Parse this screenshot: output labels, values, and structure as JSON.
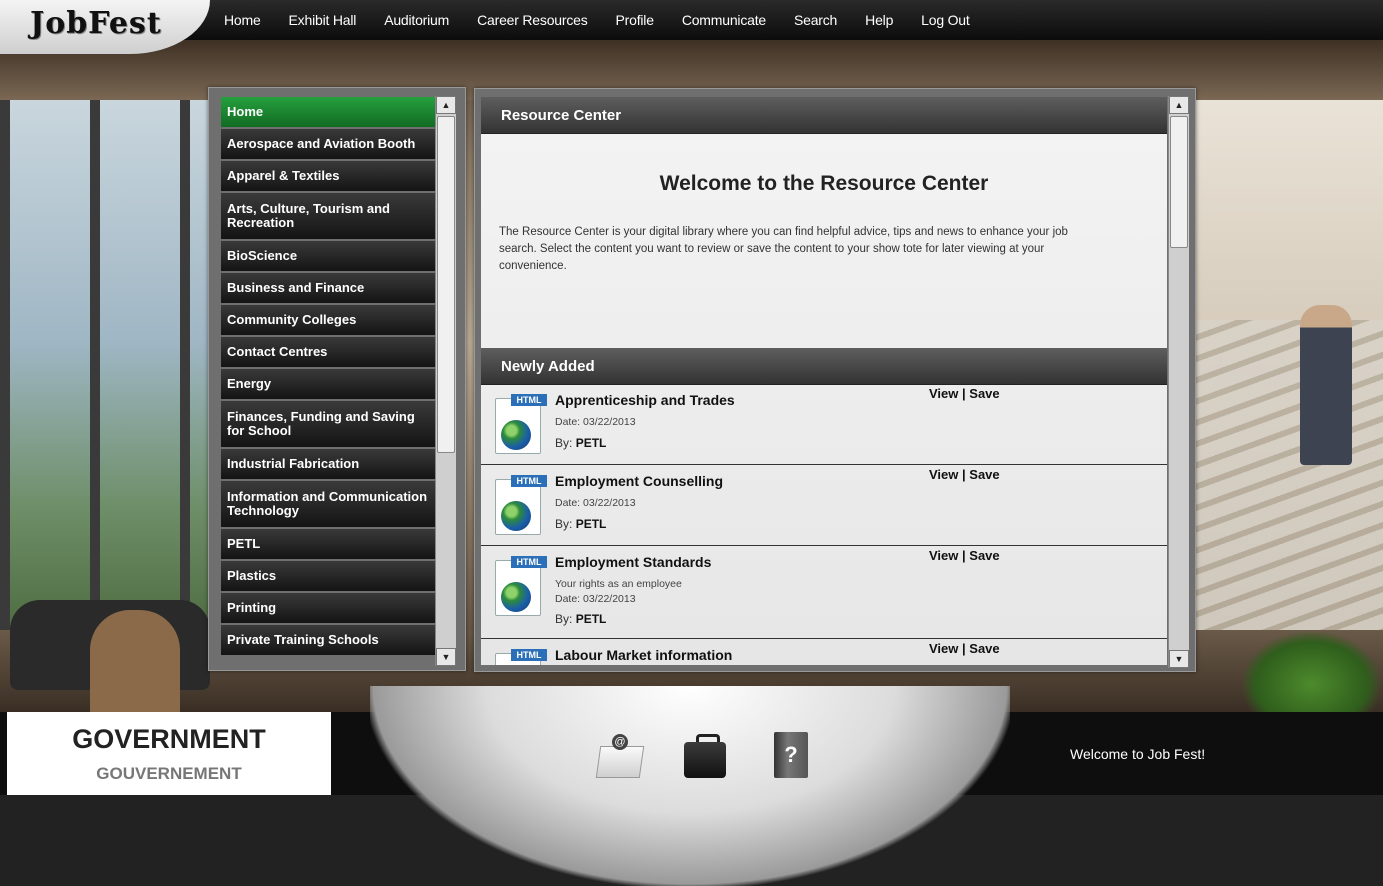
{
  "app": {
    "logo": "JobFest"
  },
  "nav": {
    "items": [
      "Home",
      "Exhibit Hall",
      "Auditorium",
      "Career Resources",
      "Profile",
      "Communicate",
      "Search",
      "Help",
      "Log Out"
    ]
  },
  "sidebar": {
    "items": [
      {
        "label": "Home",
        "active": true
      },
      {
        "label": "Aerospace and Aviation Booth"
      },
      {
        "label": "Apparel & Textiles"
      },
      {
        "label": "Arts, Culture, Tourism and Recreation"
      },
      {
        "label": "BioScience"
      },
      {
        "label": "Business and Finance"
      },
      {
        "label": "Community Colleges"
      },
      {
        "label": "Contact Centres"
      },
      {
        "label": "Energy"
      },
      {
        "label": "Finances, Funding and Saving for School"
      },
      {
        "label": "Industrial Fabrication"
      },
      {
        "label": "Information and Communication Technology"
      },
      {
        "label": "PETL"
      },
      {
        "label": "Plastics"
      },
      {
        "label": "Printing"
      },
      {
        "label": "Private Training Schools"
      }
    ]
  },
  "panel": {
    "header": "Resource Center",
    "welcome_title": "Welcome to the Resource Center",
    "intro": "The Resource Center is your digital library where you can find helpful advice, tips and news to enhance your job search. Select the content you want to review or save the content to your show tote for later viewing at your convenience.",
    "newly_added_header": "Newly Added",
    "icon_tag": "HTML",
    "view_label": "View",
    "save_label": "Save",
    "separator": "|",
    "items": [
      {
        "title": "Apprenticeship and Trades",
        "date": "Date: 03/22/2013",
        "by_prefix": "By:",
        "by": "PETL"
      },
      {
        "title": "Employment Counselling",
        "date": "Date: 03/22/2013",
        "by_prefix": "By:",
        "by": "PETL"
      },
      {
        "title": "Employment Standards",
        "desc": "Your rights as an employee",
        "date": "Date: 03/22/2013",
        "by_prefix": "By:",
        "by": "PETL"
      },
      {
        "title": "Labour Market information"
      }
    ]
  },
  "footer": {
    "gov_en": "GOVERNMENT",
    "gov_fr": "GOUVERNEMENT",
    "welcome": "Welcome to Job Fest!",
    "help_glyph": "?"
  }
}
